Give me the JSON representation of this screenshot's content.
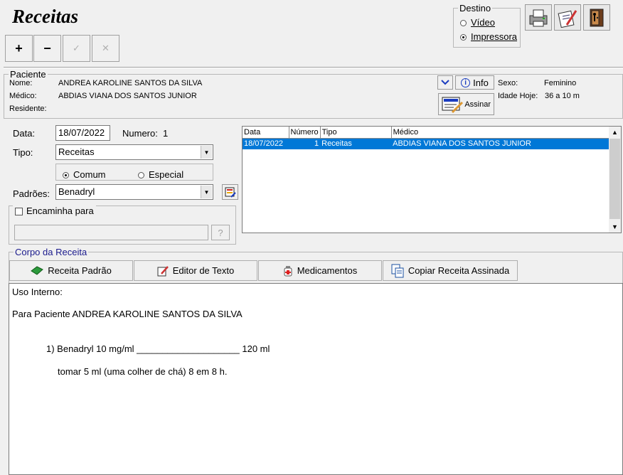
{
  "window": {
    "title": "Receitas"
  },
  "toolbar": {
    "add": "+",
    "remove": "−",
    "confirm": "✓",
    "cancel": "✕"
  },
  "destino": {
    "legend": "Destino",
    "video": "Vídeo",
    "impressora": "Impressora",
    "selected": "Impressora"
  },
  "paciente": {
    "legend": "Paciente",
    "nome_label": "Nome:",
    "nome": "ANDREA KAROLINE SANTOS DA SILVA",
    "medico_label": "Médico:",
    "medico": "ABDIAS VIANA DOS SANTOS JUNIOR",
    "residente_label": "Residente:",
    "residente": "",
    "info_button": "Info",
    "assinar_button": "Assinar",
    "sexo_label": "Sexo:",
    "sexo": "Feminino",
    "idade_label": "Idade Hoje:",
    "idade": "36 a 10 m"
  },
  "form": {
    "data_label": "Data:",
    "data": "18/07/2022",
    "numero_label": "Numero:",
    "numero": "1",
    "tipo_label": "Tipo:",
    "tipo": "Receitas",
    "comum": "Comum",
    "especial": "Especial",
    "tipo_radio_selected": "Comum",
    "padroes_label": "Padrões:",
    "padroes": "Benadryl",
    "encaminha_label": "Encaminha para",
    "encaminha_value": "",
    "lookup_button": "?"
  },
  "grid": {
    "columns": [
      "Data",
      "Número",
      "Tipo",
      "Médico"
    ],
    "rows": [
      {
        "data": "18/07/2022",
        "numero": "1",
        "tipo": "Receitas",
        "medico": "ABDIAS VIANA DOS SANTOS JUNIOR"
      }
    ]
  },
  "corpo": {
    "legend": "Corpo da Receita",
    "buttons": [
      "Receita Padrão",
      "Editor de Texto",
      "Medicamentos",
      "Copiar Receita Assinada"
    ],
    "text": {
      "line1": "Uso Interno:",
      "line2": "Para Paciente ANDREA KAROLINE SANTOS DA SILVA",
      "line3": "1) Benadryl 10 mg/ml ____________________ 120 ml",
      "line4": "tomar 5 ml (uma colher de chá) 8 em 8 h."
    }
  }
}
